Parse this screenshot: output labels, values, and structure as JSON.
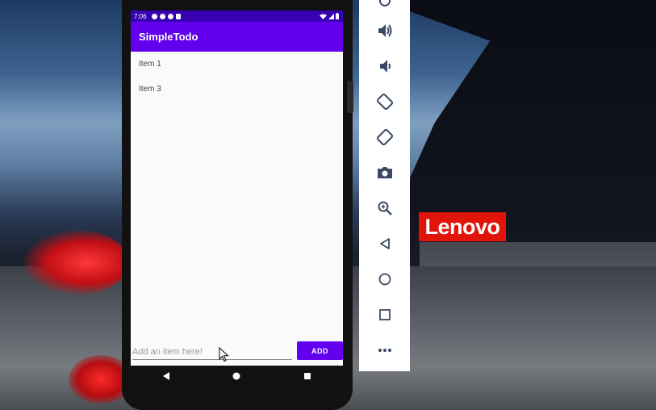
{
  "device": {
    "status_bar": {
      "time": "7:06"
    },
    "app_bar": {
      "title": "SimpleTodo"
    },
    "todo_list": {
      "items": [
        "Item 1",
        "Item 3"
      ]
    },
    "add_form": {
      "placeholder": "Add an item here!",
      "value": "",
      "add_label": "ADD"
    }
  },
  "wallpaper": {
    "brand": "Lenovo",
    "brand_color": "#e1140a"
  },
  "theme": {
    "primary": "#6200ee",
    "primary_dark": "#3700b3"
  },
  "emulator_toolbar": {
    "buttons": [
      "power-icon",
      "volume-up-icon",
      "volume-down-icon",
      "rotate-left-icon",
      "rotate-right-icon",
      "screenshot-icon",
      "zoom-icon",
      "back-icon",
      "home-icon",
      "overview-icon",
      "more-icon"
    ]
  }
}
